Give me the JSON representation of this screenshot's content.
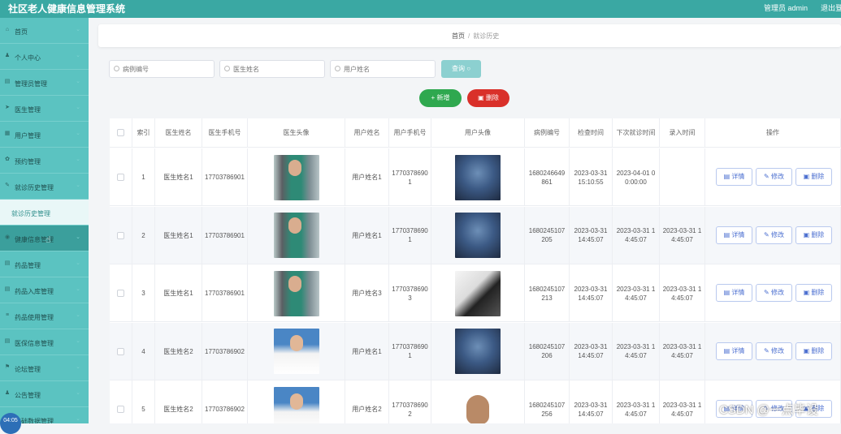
{
  "header": {
    "title": "社区老人健康信息管理系统",
    "user": "管理员 admin",
    "logout": "退出登录"
  },
  "sidebar": {
    "items": [
      {
        "label": "首页",
        "icon": "home-icon"
      },
      {
        "label": "个人中心",
        "icon": "user-icon"
      },
      {
        "label": "管理员管理",
        "icon": "briefcase-icon"
      },
      {
        "label": "医生管理",
        "icon": "send-icon"
      },
      {
        "label": "用户管理",
        "icon": "cart-icon"
      },
      {
        "label": "预约管理",
        "icon": "settings-icon"
      },
      {
        "label": "就诊历史管理",
        "icon": "edit-icon"
      },
      {
        "label": "就诊历史管理",
        "icon": ""
      },
      {
        "label": "健康信息管理",
        "icon": "circle-icon"
      },
      {
        "label": "药品管理",
        "icon": "doc-icon"
      },
      {
        "label": "药品入库管理",
        "icon": "doc-icon"
      },
      {
        "label": "药品使用管理",
        "icon": "list-icon"
      },
      {
        "label": "医保信息管理",
        "icon": "doc-icon"
      },
      {
        "label": "论坛管理",
        "icon": "flag-icon"
      },
      {
        "label": "公告管理",
        "icon": "user-icon"
      },
      {
        "label": "基础数据管理",
        "icon": "circle-icon"
      }
    ],
    "clock": "04:05"
  },
  "breadcrumb": {
    "home": "首页",
    "separator": "/",
    "current": "就诊历史"
  },
  "search": {
    "fields": [
      {
        "placeholder": "病例编号"
      },
      {
        "placeholder": "医生姓名"
      },
      {
        "placeholder": "用户姓名"
      }
    ],
    "button": "查询"
  },
  "actions": {
    "add": "+ 新增",
    "delete": "删除"
  },
  "table": {
    "headers": [
      "",
      "索引",
      "医生姓名",
      "医生手机号",
      "医生头像",
      "用户姓名",
      "用户手机号",
      "用户头像",
      "病例编号",
      "检查时间",
      "下次就诊时间",
      "录入时间",
      "操作"
    ],
    "rows": [
      {
        "index": "1",
        "doctor": "医生姓名1",
        "doctor_phone": "17703786901",
        "doctor_avatar": "doc-a",
        "user": "用户姓名1",
        "user_phone": "17703786901",
        "user_avatar": "user-a",
        "case_no": "1680246649861",
        "check_time": "2023-03-31 15:10:55",
        "next_time": "2023-04-01 00:00:00",
        "entry_time": ""
      },
      {
        "index": "2",
        "doctor": "医生姓名1",
        "doctor_phone": "17703786901",
        "doctor_avatar": "doc-a",
        "user": "用户姓名1",
        "user_phone": "17703786901",
        "user_avatar": "user-a",
        "case_no": "1680245107205",
        "check_time": "2023-03-31 14:45:07",
        "next_time": "2023-03-31 14:45:07",
        "entry_time": "2023-03-31 14:45:07"
      },
      {
        "index": "3",
        "doctor": "医生姓名1",
        "doctor_phone": "17703786901",
        "doctor_avatar": "doc-a",
        "user": "用户姓名3",
        "user_phone": "17703786903",
        "user_avatar": "user-b",
        "case_no": "1680245107213",
        "check_time": "2023-03-31 14:45:07",
        "next_time": "2023-03-31 14:45:07",
        "entry_time": "2023-03-31 14:45:07"
      },
      {
        "index": "4",
        "doctor": "医生姓名2",
        "doctor_phone": "17703786902",
        "doctor_avatar": "doc-b",
        "user": "用户姓名1",
        "user_phone": "17703786901",
        "user_avatar": "user-a",
        "case_no": "1680245107206",
        "check_time": "2023-03-31 14:45:07",
        "next_time": "2023-03-31 14:45:07",
        "entry_time": "2023-03-31 14:45:07"
      },
      {
        "index": "5",
        "doctor": "医生姓名2",
        "doctor_phone": "17703786902",
        "doctor_avatar": "doc-b",
        "user": "用户姓名2",
        "user_phone": "17703786902",
        "user_avatar": "user-c",
        "case_no": "1680245107256",
        "check_time": "2023-03-31 14:45:07",
        "next_time": "2023-03-31 14:45:07",
        "entry_time": "2023-03-31 14:45:07"
      }
    ],
    "row_actions": {
      "detail": "详情",
      "edit": "修改",
      "delete": "删除"
    }
  },
  "watermark": "CSDN @一点毕设",
  "colors": {
    "topbar": "#3aa8a3",
    "sidebar": "#5bc3c1",
    "add": "#2fa84f",
    "delete": "#d9302a",
    "search": "#8cd0d0"
  }
}
